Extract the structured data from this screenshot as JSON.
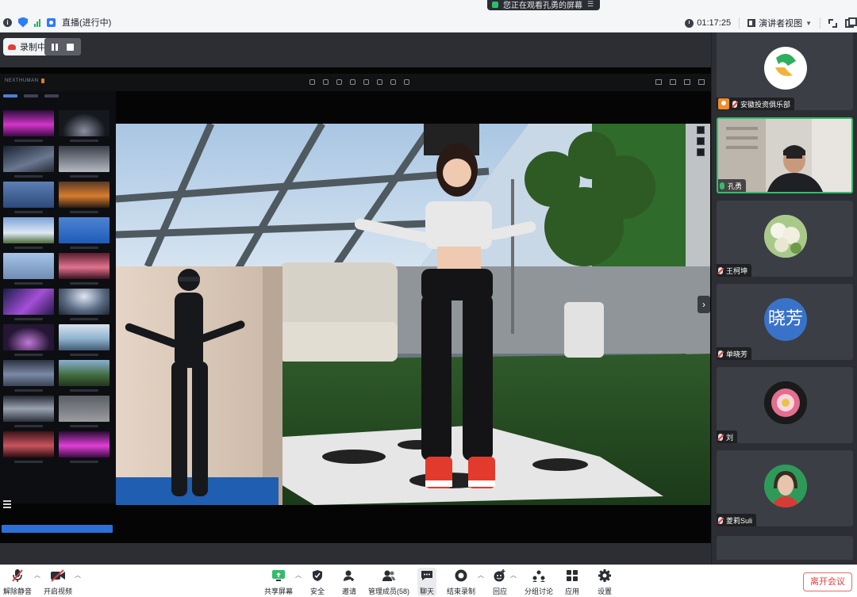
{
  "topbar": {
    "live_label": "直播(进行中)",
    "viewing_label": "您正在观看孔勇的屏幕",
    "timer": "01:17:25",
    "view_mode": "演讲者视图"
  },
  "recording": {
    "label": "录制中"
  },
  "participants": [
    {
      "name": "安徽投资俱乐部",
      "avatar": "logo",
      "host": true,
      "mic": "muted"
    },
    {
      "name": "孔勇",
      "avatar": "video",
      "host": false,
      "mic": "speaking",
      "active": true
    },
    {
      "name": "王柯坤",
      "avatar": "flowers",
      "host": false,
      "mic": "muted"
    },
    {
      "name": "单晓芳",
      "avatar": "晓芳",
      "host": false,
      "mic": "muted"
    },
    {
      "name": "刘",
      "avatar": "rose",
      "host": false,
      "mic": "muted"
    },
    {
      "name": "菱莉Suli",
      "avatar": "portrait",
      "host": false,
      "mic": "muted"
    }
  ],
  "toolbar": {
    "unmute": "解除静音",
    "start_video": "开启视频",
    "share_screen": "共享屏幕",
    "security": "安全",
    "invite": "邀请",
    "members": "管理成员(58)",
    "chat": "聊天",
    "end_recording": "结束录制",
    "reactions": "回应",
    "breakout": "分组讨论",
    "apps": "应用",
    "settings": "设置",
    "leave": "离开会议"
  },
  "colors": {
    "accent": "#2e7cf6",
    "active_speaker": "#2fbf6a",
    "leave": "#e03d3d"
  }
}
